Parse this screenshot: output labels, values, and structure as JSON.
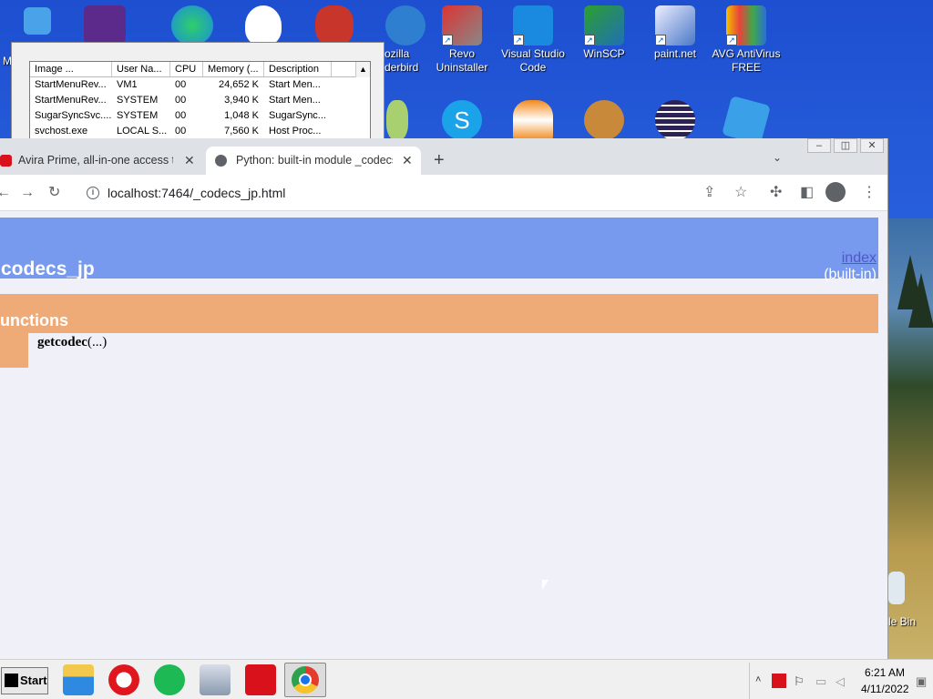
{
  "desktop": {
    "icons": [
      {
        "label": "Mozilla Thunderbird",
        "shown": "ozilla\nderbird"
      },
      {
        "label": "Revo Uninstaller",
        "line1": "Revo",
        "line2": "Uninstaller"
      },
      {
        "label": "Visual Studio Code",
        "line1": "Visual Studio",
        "line2": "Code"
      },
      {
        "label": "WinSCP",
        "line1": "WinSCP",
        "line2": ""
      },
      {
        "label": "paint.net",
        "line1": "paint.net",
        "line2": ""
      },
      {
        "label": "AVG AntiVirus FREE",
        "line1": "AVG AntiVirus",
        "line2": "FREE"
      }
    ],
    "partial_left_label": "M",
    "thunderbird_line1": "ozilla",
    "thunderbird_line2": "derbird",
    "recycle_bin_label": "le Bin"
  },
  "task_manager": {
    "columns": [
      "Image ...",
      "User Na...",
      "CPU",
      "Memory (...",
      "Description"
    ],
    "rows": [
      {
        "image": "StartMenuRev...",
        "user": "VM1",
        "cpu": "00",
        "memory": "24,652 K",
        "desc": "Start Men..."
      },
      {
        "image": "StartMenuRev...",
        "user": "SYSTEM",
        "cpu": "00",
        "memory": "3,940 K",
        "desc": "Start Men..."
      },
      {
        "image": "SugarSyncSvc....",
        "user": "SYSTEM",
        "cpu": "00",
        "memory": "1,048 K",
        "desc": "SugarSync..."
      },
      {
        "image": "svchost.exe",
        "user": "LOCAL S...",
        "cpu": "00",
        "memory": "7,560 K",
        "desc": "Host Proc..."
      }
    ]
  },
  "browser": {
    "tabs": [
      {
        "title": "Avira Prime, all-in-one access to",
        "active": false
      },
      {
        "title": "Python: built-in module _codecs_",
        "active": true
      }
    ],
    "new_tab": "+",
    "url": "localhost:7464/_codecs_jp.html"
  },
  "page": {
    "module_title": "codecs_jp",
    "index_link": "index",
    "builtin_label": "(built-in)",
    "functions_title": "unctions",
    "functions": [
      {
        "name": "getcodec",
        "args": "(...)"
      }
    ]
  },
  "taskbar": {
    "start_label": "Start",
    "apps": [
      "file-explorer",
      "opera",
      "spotify",
      "network-monitor",
      "avira",
      "chrome"
    ],
    "clock_time": "6:21 AM",
    "clock_date": "4/11/2022"
  },
  "colors": {
    "heading_bar": "#7799ee",
    "functions_bar": "#eeaa77",
    "page_bg": "#f0f0f8",
    "link": "#5555cc"
  }
}
